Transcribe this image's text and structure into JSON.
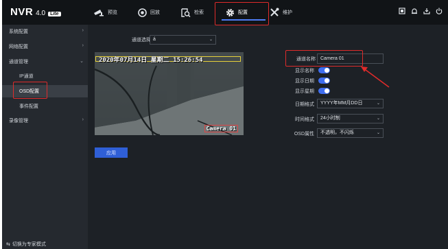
{
  "brand": {
    "name": "NVR",
    "version": "4.0",
    "edition": "Lite"
  },
  "nav": [
    {
      "label": "预览",
      "icon": "camera-icon"
    },
    {
      "label": "回放",
      "icon": "playback-icon"
    },
    {
      "label": "检索",
      "icon": "search-icon"
    },
    {
      "label": "配置",
      "icon": "gear-icon"
    },
    {
      "label": "维护",
      "icon": "tools-icon"
    }
  ],
  "top_icons": [
    "grid-icon",
    "bell-icon",
    "logout-icon",
    "power-icon"
  ],
  "sidebar": {
    "items": [
      {
        "label": "系统配置"
      },
      {
        "label": "网络配置"
      },
      {
        "label": "通道管理"
      },
      {
        "label": "IP通道"
      },
      {
        "label": "OSD配置"
      },
      {
        "label": "事件配置"
      },
      {
        "label": "录像管理"
      }
    ],
    "footer": "切换为专家模式"
  },
  "channel_select": {
    "label": "通道选择",
    "value": "á"
  },
  "preview": {
    "timestamp": "2020年07月14日 星期二 15:26:54",
    "channel_overlay": "Camera 01"
  },
  "form": {
    "channel_name": {
      "label": "通道名称",
      "value": "Camera 01"
    },
    "show_name": {
      "label": "显示名称",
      "on": true
    },
    "show_date": {
      "label": "显示日期",
      "on": true
    },
    "show_week": {
      "label": "显示星期",
      "on": true
    },
    "date_format": {
      "label": "日期格式",
      "value": "YYYY年MM月DD日"
    },
    "time_format": {
      "label": "时间格式",
      "value": "24小时制"
    },
    "osd_attr": {
      "label": "OSD属性",
      "value": "不透明，不闪烁"
    }
  },
  "apply_label": "应用",
  "colors": {
    "accent": "#3f6ef0",
    "highlight": "#e02b2b"
  }
}
